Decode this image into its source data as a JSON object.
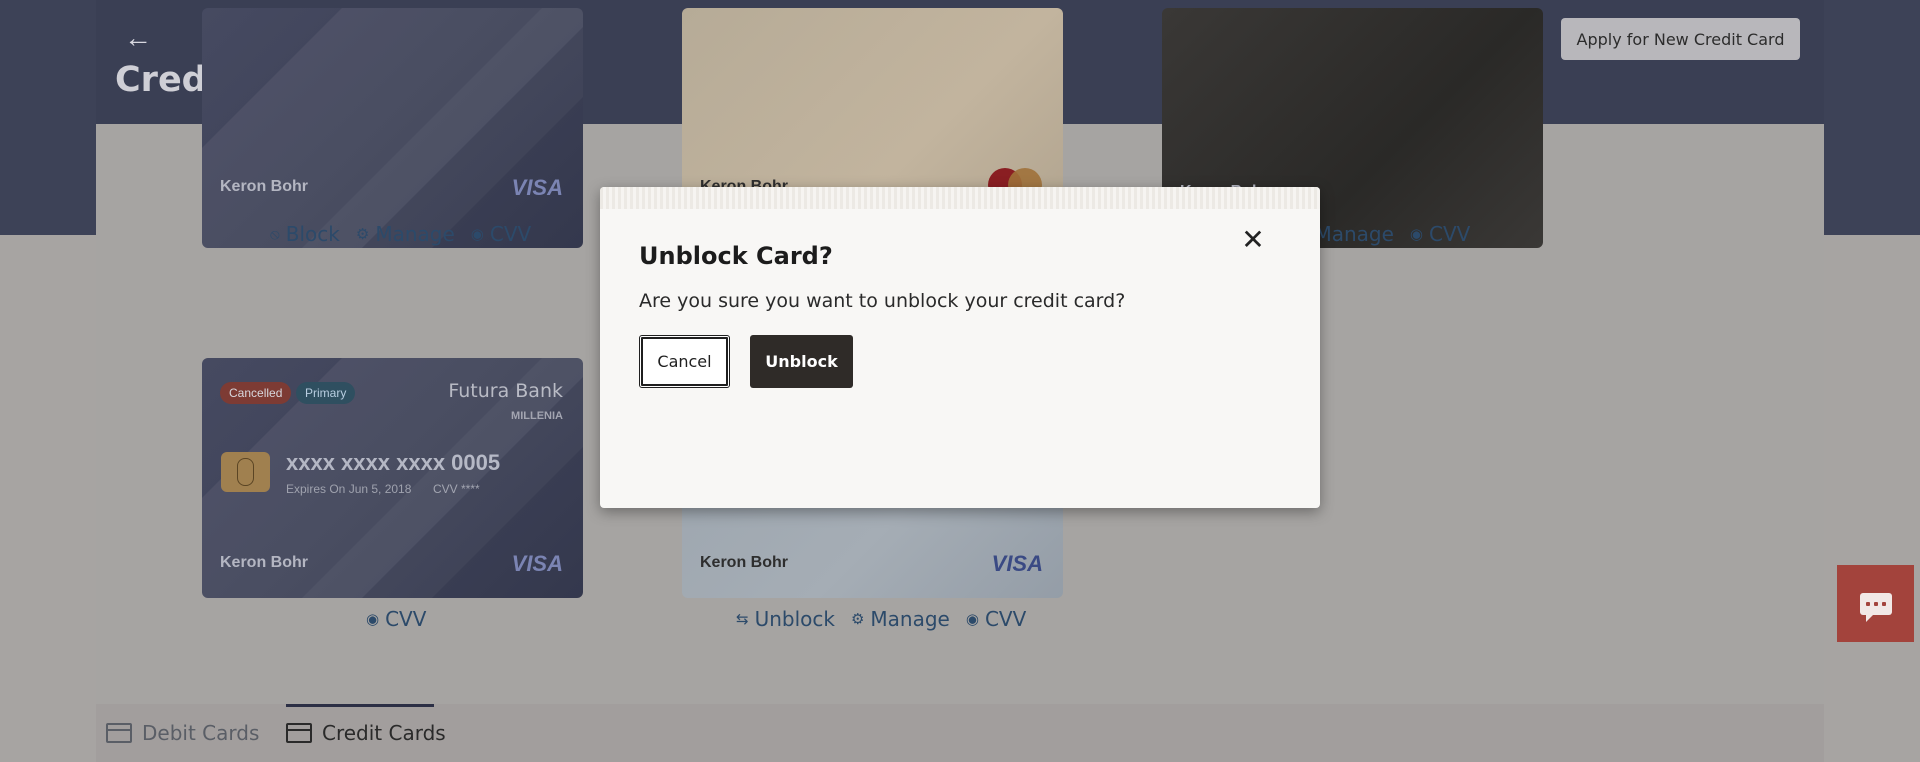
{
  "header": {
    "back_icon": "←",
    "title": "Credit Cards List",
    "apply_button": "Apply for New Credit Card"
  },
  "cards": {
    "row1": [
      {
        "holder": "Keron Bohr",
        "network": "VISA",
        "actions": [
          "Block",
          "Manage",
          "CVV"
        ]
      },
      {
        "holder": "Keron Bohr",
        "network": "mastercard"
      },
      {
        "holder": "Keron Bohr",
        "actions": [
          "Manage",
          "CVV"
        ]
      }
    ],
    "featured": {
      "badges": [
        "Cancelled",
        "Primary"
      ],
      "bank": "Futura Bank",
      "tier": "MILLENIA",
      "number": "xxxx xxxx xxxx 0005",
      "expiry": "Expires On Jun 5, 2018",
      "cvv": "CVV ****",
      "holder": "Keron Bohr",
      "network": "VISA",
      "actions": [
        "CVV"
      ]
    },
    "row2_second": {
      "holder": "Keron Bohr",
      "network": "VISA",
      "actions": [
        "Unblock",
        "Manage",
        "CVV"
      ]
    }
  },
  "tabs": {
    "debit": "Debit Cards",
    "credit": "Credit Cards"
  },
  "modal": {
    "title": "Unblock Card?",
    "message": "Are you sure you want to unblock your credit card?",
    "cancel": "Cancel",
    "confirm": "Unblock"
  }
}
